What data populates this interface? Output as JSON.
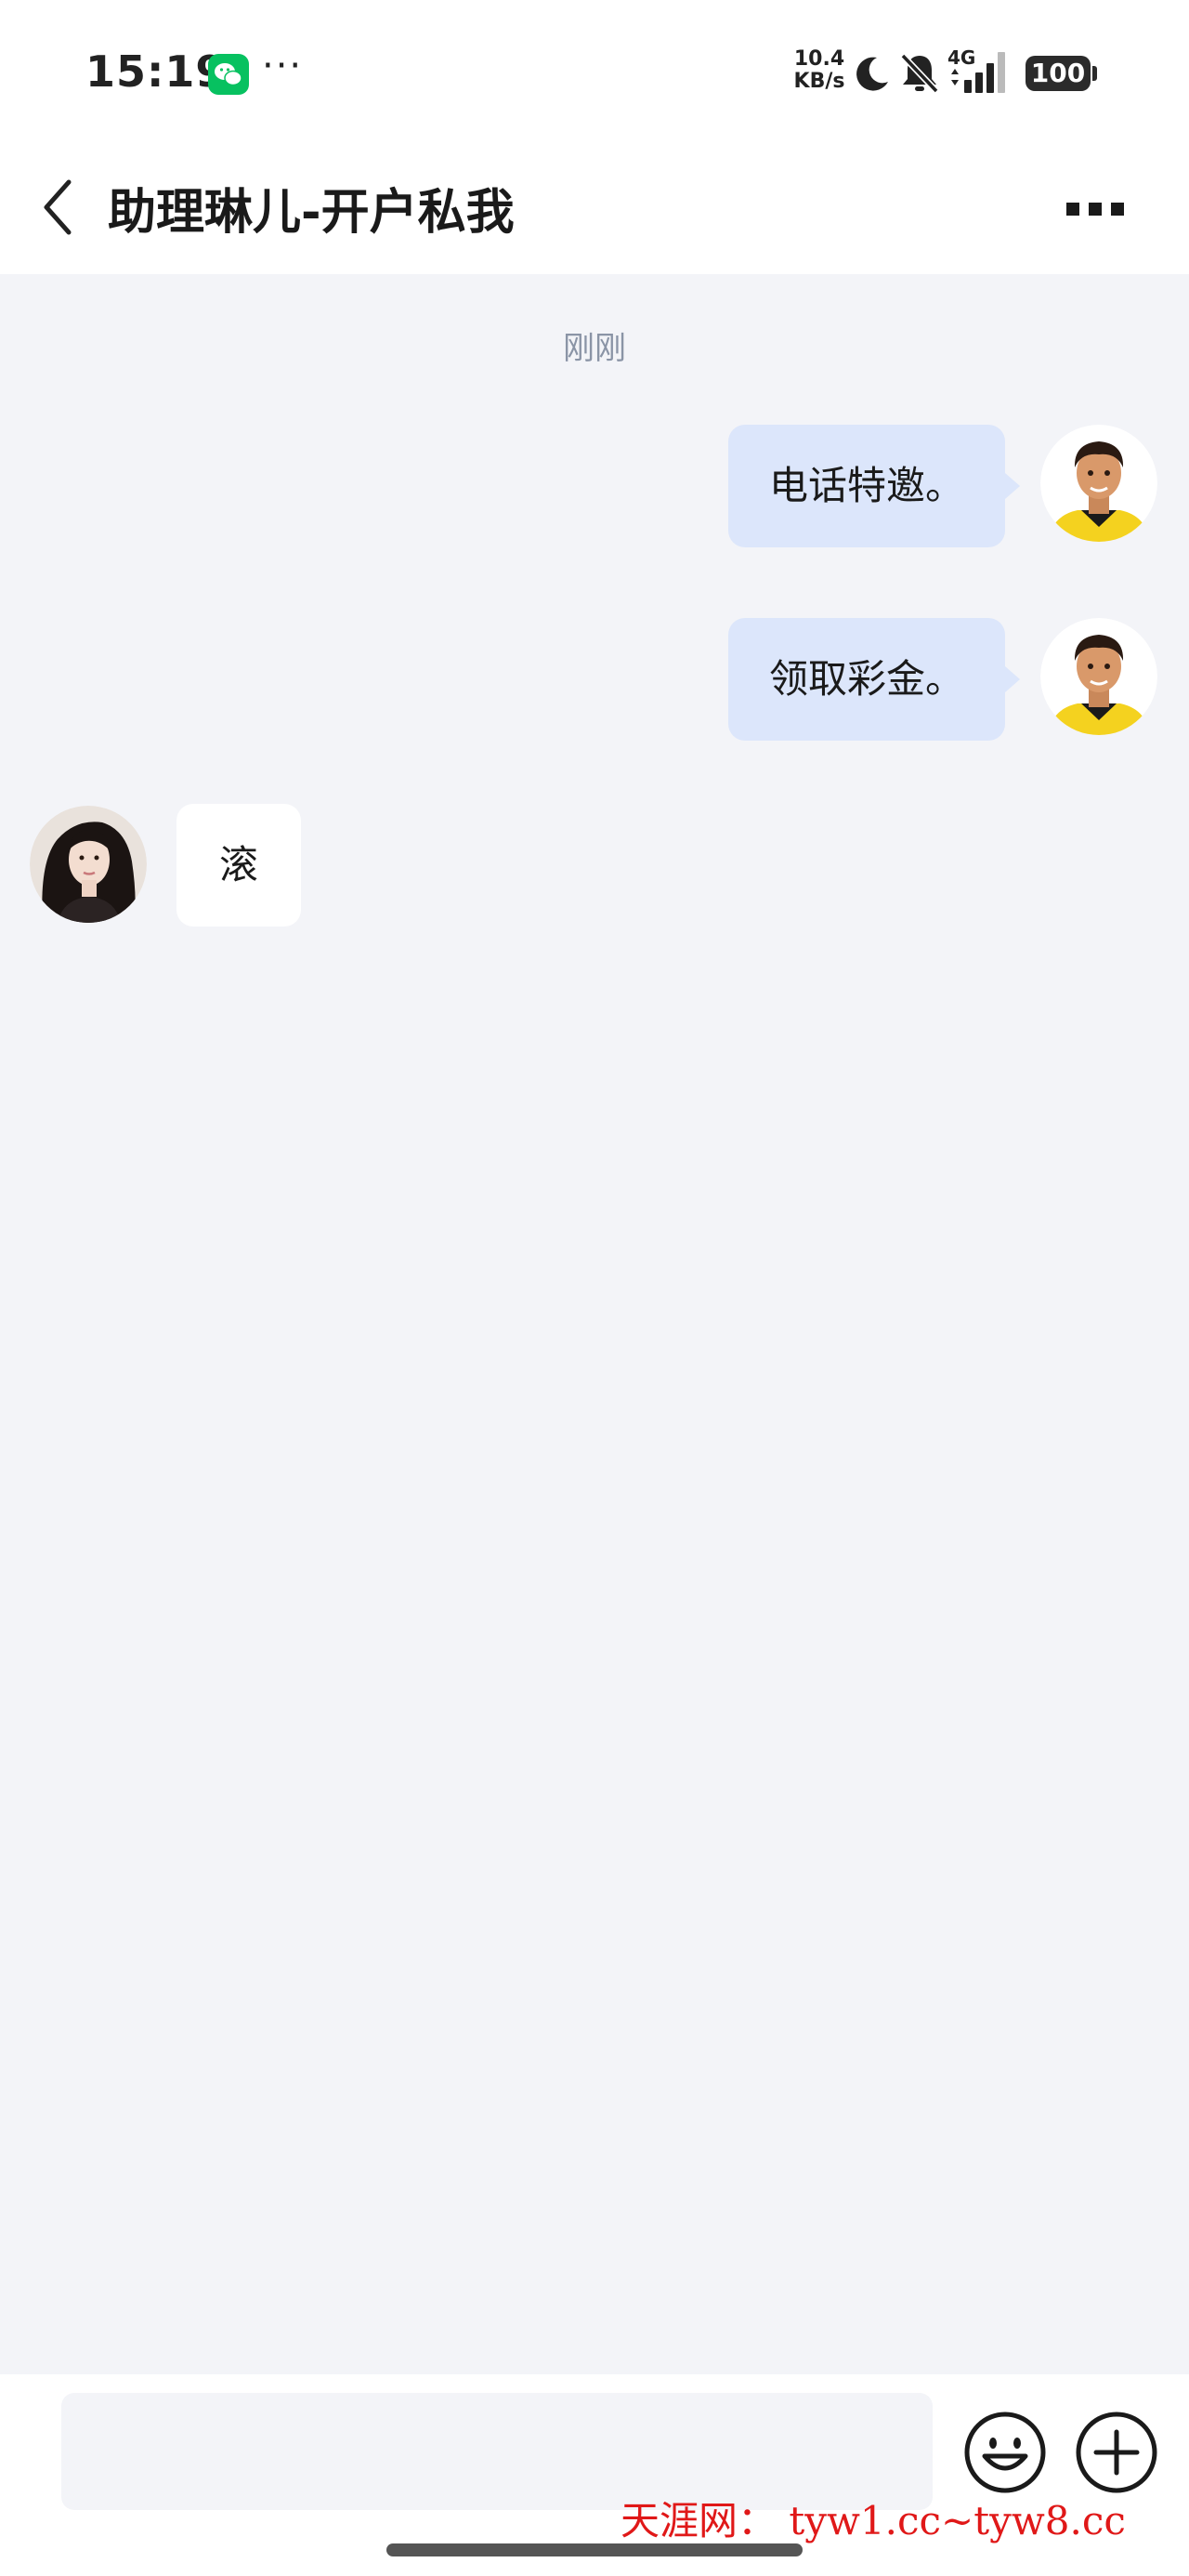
{
  "status_bar": {
    "time": "15:19",
    "more": "···",
    "net_speed_value": "10.4",
    "net_speed_unit": "KB/s",
    "network": "4G",
    "battery": "100"
  },
  "header": {
    "title": "助理琳儿-开户私我"
  },
  "chat": {
    "timestamp": "刚刚",
    "messages": [
      {
        "direction": "outgoing",
        "text": "电话特邀。"
      },
      {
        "direction": "outgoing",
        "text": "领取彩金。"
      },
      {
        "direction": "incoming",
        "text": "滚"
      }
    ]
  },
  "input": {
    "placeholder": ""
  },
  "watermark": "天涯网： tyw1.cc~tyw8.cc",
  "icons": {
    "back": "chevron-left-icon",
    "more": "more-dots-icon",
    "emoji": "smiley-icon",
    "plus": "plus-circle-icon",
    "app": "wechat-icon"
  },
  "colors": {
    "outgoing_bubble": "#dce6fb",
    "incoming_bubble": "#ffffff",
    "chat_background": "#f3f4f8",
    "timestamp": "#8a94a6",
    "wechat_green": "#07c160",
    "watermark": "#e01818"
  }
}
